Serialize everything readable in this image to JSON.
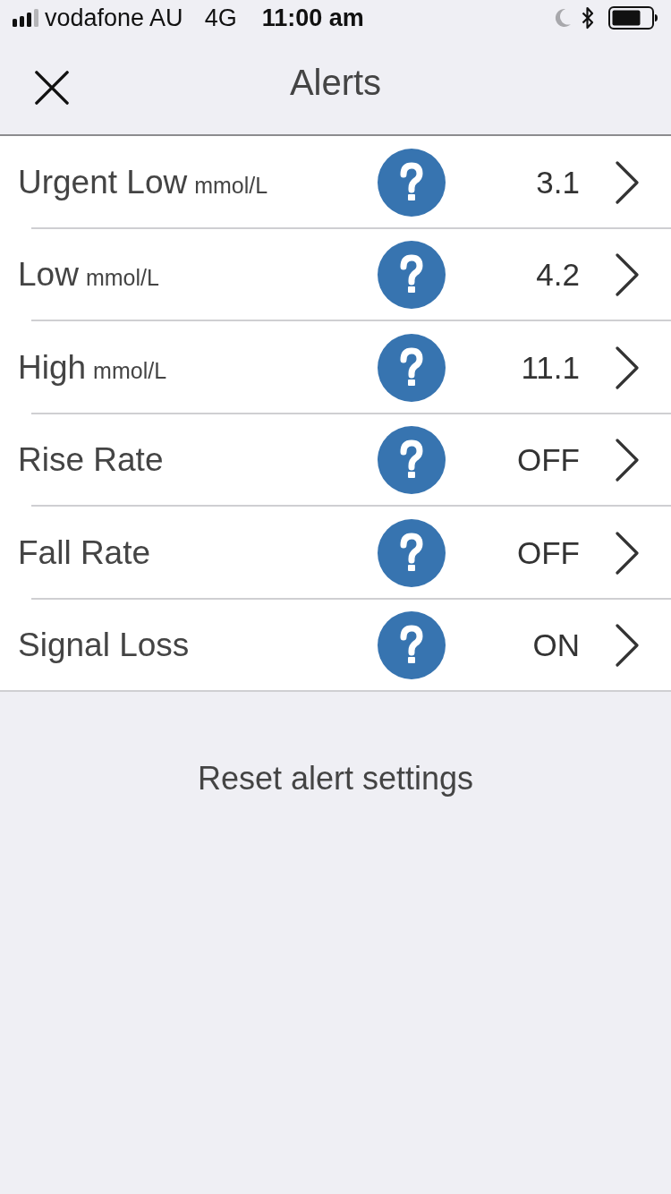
{
  "status_bar": {
    "carrier": "vodafone AU",
    "network": "4G",
    "time": "11:00 am"
  },
  "nav": {
    "title": "Alerts"
  },
  "alerts": [
    {
      "label": "Urgent Low",
      "unit": "mmol/L",
      "value": "3.1"
    },
    {
      "label": "Low",
      "unit": "mmol/L",
      "value": "4.2"
    },
    {
      "label": "High",
      "unit": "mmol/L",
      "value": "11.1"
    },
    {
      "label": "Rise Rate",
      "value": "OFF"
    },
    {
      "label": "Fall Rate",
      "value": "OFF"
    },
    {
      "label": "Signal Loss",
      "value": "ON"
    }
  ],
  "reset_button": {
    "label": "Reset alert settings"
  }
}
